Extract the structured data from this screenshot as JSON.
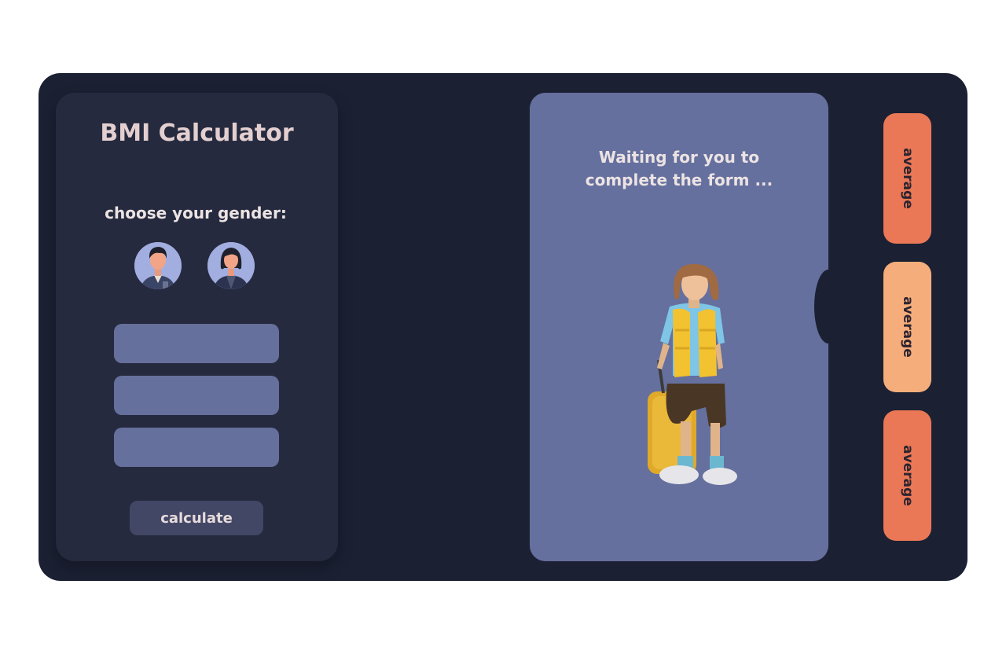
{
  "form": {
    "title": "BMI Calculator",
    "gender_label": "choose your gender:",
    "genders": [
      "male",
      "female"
    ],
    "fields": [
      {
        "value": "",
        "placeholder": ""
      },
      {
        "value": "",
        "placeholder": ""
      },
      {
        "value": "",
        "placeholder": ""
      }
    ],
    "calculate_label": "calculate"
  },
  "result": {
    "message_line1": "Waiting for you to",
    "message_line2": "complete the form ..."
  },
  "tags": [
    {
      "label": "average",
      "color": "#ea7856"
    },
    {
      "label": "average",
      "color": "#f5ae7b"
    },
    {
      "label": "average",
      "color": "#ea7856"
    }
  ],
  "colors": {
    "background": "#1b2033",
    "form_card": "#252a3e",
    "result_card": "#65709e",
    "input": "#66709d",
    "button": "#434766",
    "title_text": "#e4cfd0"
  },
  "icons": {
    "male_avatar": "male-avatar-icon",
    "female_avatar": "female-avatar-icon"
  }
}
